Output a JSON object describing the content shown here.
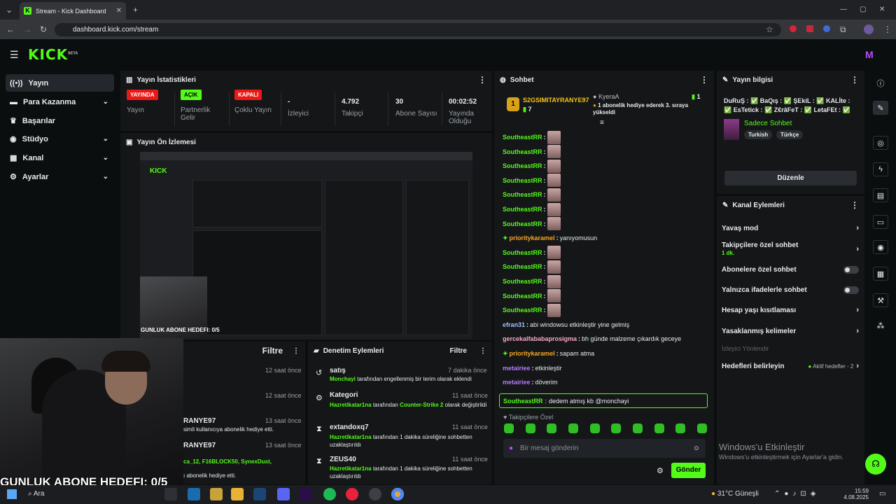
{
  "browser": {
    "tab_title": "Stream - Kick Dashboard",
    "url": "dashboard.kick.com/stream"
  },
  "header": {
    "logo": "KICK",
    "logo_beta": "BETA"
  },
  "sidebar": {
    "items": [
      {
        "label": "Yayın",
        "icon": "broadcast-icon"
      },
      {
        "label": "Para Kazanma",
        "icon": "money-icon"
      },
      {
        "label": "Başarılar",
        "icon": "trophy-icon"
      },
      {
        "label": "Stüdyo",
        "icon": "studio-icon"
      },
      {
        "label": "Kanal",
        "icon": "channel-icon"
      },
      {
        "label": "Ayarlar",
        "icon": "gear-icon"
      }
    ]
  },
  "stats": {
    "title": "Yayın İstatistikleri",
    "items": [
      {
        "badge": "YAYINDA",
        "label": "Yayın"
      },
      {
        "badge": "AÇIK",
        "label": "Partnerlik Gelir"
      },
      {
        "badge": "KAPALI",
        "label": "Çoklu Yayın"
      },
      {
        "value": "-",
        "label": "İzleyici"
      },
      {
        "value": "4.792",
        "label": "Takipçi"
      },
      {
        "value": "30",
        "label": "Abone Sayısı"
      },
      {
        "value": "00:02:52",
        "label": "Yayında Olduğu"
      }
    ]
  },
  "preview": {
    "title": "Yayın Ön İzlemesi",
    "overlay": "GUNLUK ABONE HEDEFI: 0/5"
  },
  "activity": {
    "filter": "Filtre",
    "rows": [
      {
        "time": "12 saat önce",
        "name": "",
        "text": ""
      },
      {
        "time": "12 saat önce",
        "name": "",
        "text": ""
      },
      {
        "time": "13 saat önce",
        "name": "RANYE97",
        "text": "simli kullanıcıya abonelik hediye etti."
      },
      {
        "time": "13 saat önce",
        "name": "RANYE97",
        "text": ""
      },
      {
        "time": "",
        "name": "ca_12, F16BLOCK50, SynexDust,",
        "text": "ı abonelik hediye etti."
      }
    ]
  },
  "moderation": {
    "title": "Denetim Eylemleri",
    "filter": "Filtre",
    "rows": [
      {
        "title": "satış",
        "time": "7 dakika önce",
        "actor": "Monchayi",
        "text": "tarafından engellenmiş bir terim olarak eklendi",
        "extra": ""
      },
      {
        "title": "Kategori",
        "time": "11 saat önce",
        "actor": "Hazretikatar1na",
        "text": "tarafından",
        "link": "Counter-Strike 2",
        "extra": "olarak değiştirildi"
      },
      {
        "title": "extandoxq7",
        "time": "11 saat önce",
        "actor": "Hazretikatar1na",
        "text": "tarafından 1 dakika süreliğine sohbetten uzaklaştırıldı",
        "extra": ""
      },
      {
        "title": "ZEUS40",
        "time": "11 saat önce",
        "actor": "Hazretikatar1na",
        "text": "tarafından 1 dakika süreliğine sohbetten uzaklaştırıldı",
        "extra": ""
      }
    ]
  },
  "chat": {
    "title": "Sohbet",
    "gifter": {
      "name": "S2GSIMITAYRANYE97",
      "count": "7",
      "level": "1"
    },
    "event": {
      "user": "KyeraA",
      "count": "1",
      "text": "1 abonelik hediye ederek 3. sıraya yükseldi"
    },
    "messages": [
      {
        "user": "SoutheastRR",
        "text": "",
        "emote": true,
        "color": "#53fc18"
      },
      {
        "user": "SoutheastRR",
        "text": "",
        "emote": true,
        "color": "#53fc18"
      },
      {
        "user": "SoutheastRR",
        "text": "",
        "emote": true,
        "color": "#53fc18"
      },
      {
        "user": "SoutheastRR",
        "text": "",
        "emote": true,
        "color": "#53fc18"
      },
      {
        "user": "SoutheastRR",
        "text": "",
        "emote": true,
        "color": "#53fc18"
      },
      {
        "user": "SoutheastRR",
        "text": "",
        "emote": true,
        "color": "#53fc18"
      },
      {
        "user": "SoutheastRR",
        "text": "",
        "emote": true,
        "color": "#53fc18"
      },
      {
        "user": "prioritykaramel",
        "text": "yanıyomusun",
        "emote": false,
        "color": "#f5a623",
        "badge": true
      },
      {
        "user": "SoutheastRR",
        "text": "",
        "emote": true,
        "color": "#53fc18"
      },
      {
        "user": "SoutheastRR",
        "text": "",
        "emote": true,
        "color": "#53fc18"
      },
      {
        "user": "SoutheastRR",
        "text": "",
        "emote": true,
        "color": "#53fc18"
      },
      {
        "user": "SoutheastRR",
        "text": "",
        "emote": true,
        "color": "#53fc18"
      },
      {
        "user": "SoutheastRR",
        "text": "",
        "emote": true,
        "color": "#53fc18"
      },
      {
        "user": "efran31",
        "text": "abi windowsu etkinleştir yine gelmiş",
        "emote": false,
        "color": "#9ec4ff"
      },
      {
        "user": "gercekalfababaprosigma",
        "text": "bh günde malzeme çıkardık geceye",
        "emote": false,
        "color": "#f7a8c8"
      },
      {
        "user": "prioritykaramel",
        "text": "sapam atma",
        "emote": false,
        "color": "#f5a623",
        "badge": true
      },
      {
        "user": "metairiee",
        "text": "etkinleştir",
        "emote": false,
        "color": "#b57bff"
      },
      {
        "user": "metairiee",
        "text": "döverim",
        "emote": false,
        "color": "#b57bff"
      }
    ],
    "highlight": {
      "user": "SoutheastRR",
      "text": "dedem atmış kb @monchayi"
    },
    "follower_label": "Takipçilere Özel",
    "input_placeholder": "Bir mesaj gönderin",
    "send": "Gönder"
  },
  "stream_info": {
    "title": "Yayın bilgisi",
    "stream_title": "DuRuŞ : ✅ BaQış : ✅ ŞEkiL : ✅ KALİte : ✅ EsTetick : ✅ Z€râFeT : ✅ LetaFEt : ✅",
    "category": "Sadece Sohbet",
    "tags": [
      "Turkish",
      "Türkçe"
    ],
    "edit": "Düzenle"
  },
  "channel_actions": {
    "title": "Kanal Eylemleri",
    "items": [
      {
        "label": "Yavaş mod",
        "type": "chev"
      },
      {
        "label": "Takipçilere özel sohbet",
        "sub": "1 dk.",
        "type": "chev"
      },
      {
        "label": "Abonelere özel sohbet",
        "type": "toggle"
      },
      {
        "label": "Yalnızca ifadelerle sohbet",
        "type": "toggle"
      },
      {
        "label": "Hesap yaşı kısıtlaması",
        "type": "chev"
      },
      {
        "label": "Yasaklanmış kelimeler",
        "type": "chev"
      }
    ],
    "viewer_goal_label": "İzleyici Yönlendir",
    "goals": {
      "label": "Hedefleri belirleyin",
      "status": "Aktif hedefler - 2"
    }
  },
  "watermark": {
    "line1": "Windows'u Etkinleştir",
    "line2": "Windows'u etkinleştirmek için Ayarlar'a gidin."
  },
  "webcam_overlay": "GUNLUK ABONE HEDEFI: 0/5",
  "taskbar": {
    "search": "Ara",
    "weather": "31°C  Güneşli",
    "time": "15:59",
    "date": "4.08.2025"
  },
  "colors": {
    "accent": "#53fc18",
    "live": "#e91916",
    "panel": "#141618"
  }
}
